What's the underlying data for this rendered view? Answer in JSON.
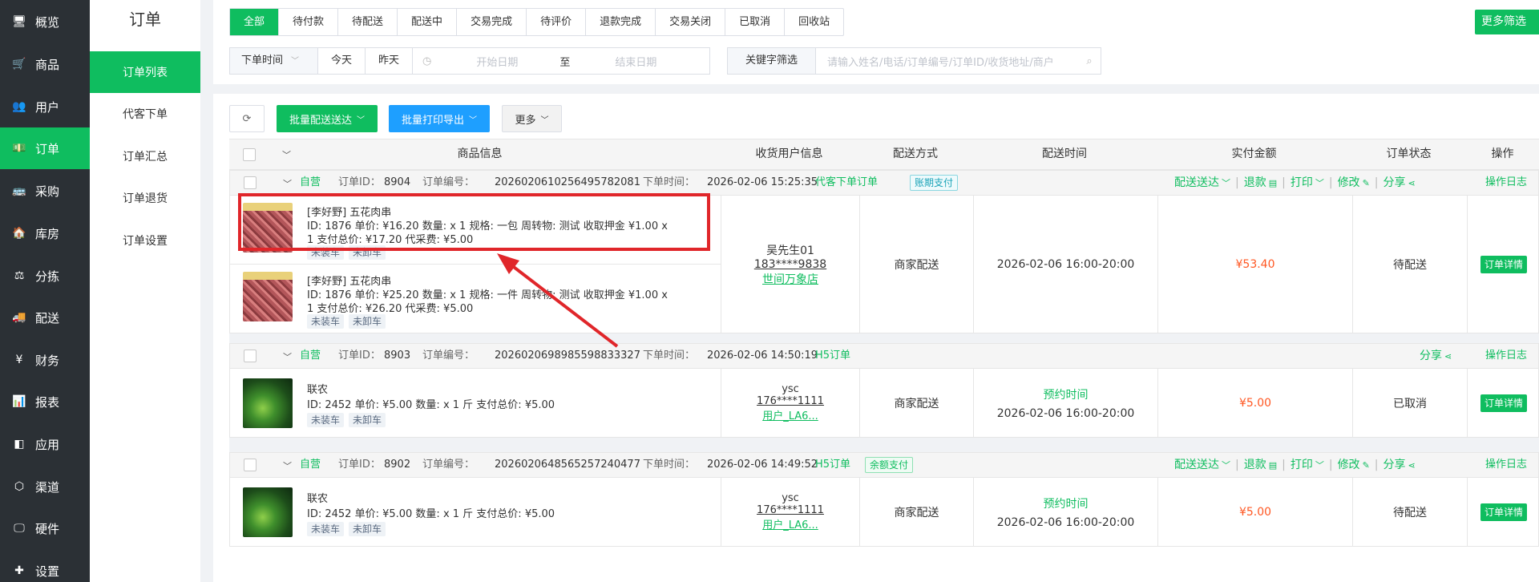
{
  "nav": [
    {
      "label": "概览",
      "icon": "monitor-icon",
      "glyph": "🖥"
    },
    {
      "label": "商品",
      "icon": "cart-icon",
      "glyph": "🛒"
    },
    {
      "label": "用户",
      "icon": "users-icon",
      "glyph": "👥"
    },
    {
      "label": "订单",
      "icon": "money-icon",
      "glyph": "💵",
      "active": true
    },
    {
      "label": "采购",
      "icon": "bus-icon",
      "glyph": "🚌"
    },
    {
      "label": "库房",
      "icon": "home-icon",
      "glyph": "🏠"
    },
    {
      "label": "分拣",
      "icon": "scale-icon",
      "glyph": "⚖"
    },
    {
      "label": "配送",
      "icon": "truck-icon",
      "glyph": "🚚"
    },
    {
      "label": "财务",
      "icon": "yen-icon",
      "glyph": "¥"
    },
    {
      "label": "报表",
      "icon": "bar-chart-icon",
      "glyph": "📊"
    },
    {
      "label": "应用",
      "icon": "app-icon",
      "glyph": "◧"
    },
    {
      "label": "渠道",
      "icon": "cube-icon",
      "glyph": "⬡"
    },
    {
      "label": "硬件",
      "icon": "desktop-icon",
      "glyph": "🖵"
    },
    {
      "label": "设置",
      "icon": "puzzle-icon",
      "glyph": "✚"
    }
  ],
  "subnav": {
    "title": "订单",
    "items": [
      "订单列表",
      "代客下单",
      "订单汇总",
      "订单退货",
      "订单设置"
    ]
  },
  "filter": {
    "tabs": [
      "全部",
      "待付款",
      "待配送",
      "配送中",
      "交易完成",
      "待评价",
      "退款完成",
      "交易关闭",
      "已取消",
      "回收站"
    ],
    "more_label": "更多筛选",
    "date_select": "下单时间",
    "today": "今天",
    "yesterday": "昨天",
    "start_placeholder": "开始日期",
    "to": "至",
    "end_placeholder": "结束日期",
    "keyword_label": "关键字筛选",
    "keyword_placeholder": "请输入姓名/电话/订单编号/订单ID/收货地址/商户"
  },
  "toolbar": {
    "deliver": "批量配送送达",
    "print": "批量打印导出",
    "more": "更多"
  },
  "headers": {
    "product": "商品信息",
    "user": "收货用户信息",
    "ship": "配送方式",
    "time": "配送时间",
    "amount": "实付金额",
    "status": "订单状态",
    "op": "操作"
  },
  "orders": [
    {
      "source": "自营",
      "id_label": "订单ID：",
      "id": "8904",
      "no_label": "订单编号：",
      "no": "2026020610256495782081",
      "time_label": "下单时间：",
      "time": "2026-02-06 15:25:35",
      "channel": "代客下单订单",
      "pay_tag": "账期支付",
      "actions": {
        "deliver": "配送送达",
        "refund": "退款",
        "print": "打印",
        "edit": "修改",
        "share": "分享",
        "log": "操作日志"
      },
      "products": [
        {
          "name": "[李好野] 五花肉串",
          "line1": "ID: 1876   单价: ¥16.20   数量: x 1   规格: 一包   周转物: 测试 收取押金 ¥1.00 x",
          "line2": "1   支付总价: ¥17.20   代采费: ¥5.00",
          "tags": [
            "未装车",
            "未卸车"
          ]
        },
        {
          "name": "[李好野] 五花肉串",
          "line1": "ID: 1876   单价: ¥25.20   数量: x 1   规格: 一件   周转物: 测试 收取押金 ¥1.00 x",
          "line2": "1   支付总价: ¥26.20   代采费: ¥5.00",
          "tags": [
            "未装车",
            "未卸车"
          ]
        }
      ],
      "user": {
        "name": "吴先生01",
        "phone": "183****9838",
        "shop": "世间万象店"
      },
      "ship": "商家配送",
      "time_pre": "",
      "delivery_time": "2026-02-06 16:00-20:00",
      "amount": "¥53.40",
      "status": "待配送",
      "detail": "订单详情"
    },
    {
      "source": "自营",
      "id_label": "订单ID：",
      "id": "8903",
      "no_label": "订单编号：",
      "no": "2026020698985598833327",
      "time_label": "下单时间：",
      "time": "2026-02-06 14:50:19",
      "channel": "H5订单",
      "actions": {
        "share": "分享",
        "log": "操作日志"
      },
      "products": [
        {
          "name": "联农",
          "line1": "ID: 2452   单价: ¥5.00   数量: x 1 斤   支付总价: ¥5.00",
          "tags": [
            "未装车",
            "未卸车"
          ]
        }
      ],
      "user": {
        "name": "ysc",
        "phone": "176****1111",
        "shop": "用户_LA6..."
      },
      "ship": "商家配送",
      "time_pre": "预约时间",
      "delivery_time": "2026-02-06 16:00-20:00",
      "amount": "¥5.00",
      "status": "已取消",
      "detail": "订单详情"
    },
    {
      "source": "自营",
      "id_label": "订单ID：",
      "id": "8902",
      "no_label": "订单编号：",
      "no": "2026020648565257240477",
      "time_label": "下单时间：",
      "time": "2026-02-06 14:49:52",
      "channel": "H5订单",
      "pay_tag": "余额支付",
      "actions": {
        "deliver": "配送送达",
        "refund": "退款",
        "print": "打印",
        "edit": "修改",
        "share": "分享",
        "log": "操作日志"
      },
      "products": [
        {
          "name": "联农",
          "line1": "ID: 2452   单价: ¥5.00   数量: x 1 斤   支付总价: ¥5.00",
          "tags": [
            "未装车",
            "未卸车"
          ]
        }
      ],
      "user": {
        "name": "ysc",
        "phone": "176****1111",
        "shop": "用户_LA6..."
      },
      "ship": "商家配送",
      "time_pre": "预约时间",
      "delivery_time": "2026-02-06 16:00-20:00",
      "amount": "¥5.00",
      "status": "待配送",
      "detail": "订单详情"
    }
  ]
}
